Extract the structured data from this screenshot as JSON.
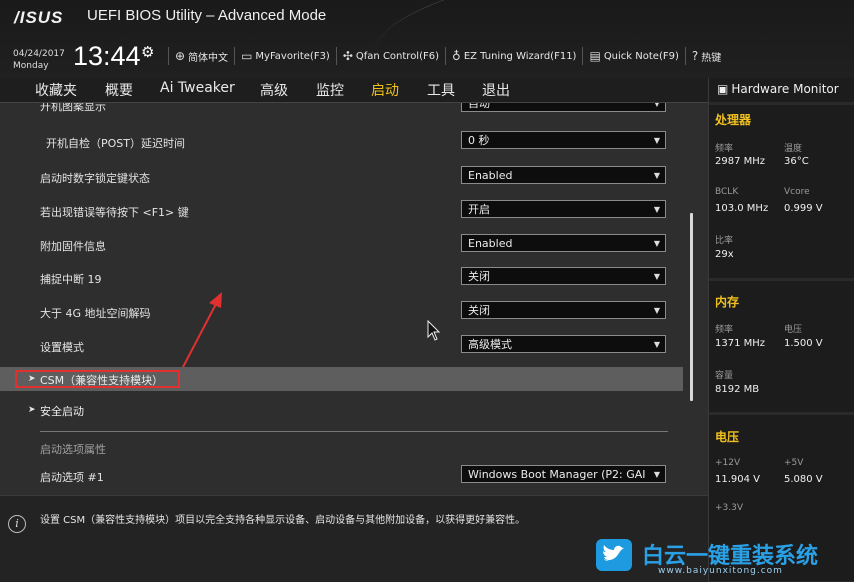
{
  "header": {
    "logo": "/ISUS",
    "title": "UEFI BIOS Utility – Advanced Mode",
    "date": "04/24/2017",
    "weekday": "Monday",
    "time": "13:44",
    "tools": [
      {
        "icon": "globe-icon",
        "label": "简体中文"
      },
      {
        "icon": "favorite-icon",
        "label": "MyFavorite(F3)"
      },
      {
        "icon": "fan-icon",
        "label": "Qfan Control(F6)"
      },
      {
        "icon": "bulb-icon",
        "label": "EZ Tuning Wizard(F11)"
      },
      {
        "icon": "note-icon",
        "label": "Quick Note(F9)"
      },
      {
        "icon": "help-icon",
        "label": "热键"
      }
    ]
  },
  "menu": {
    "tabs": [
      "收藏夹",
      "概要",
      "Ai Tweaker",
      "高级",
      "监控",
      "启动",
      "工具",
      "退出"
    ],
    "active": "启动"
  },
  "settings": [
    {
      "label": "开机自检（POST）延迟时间",
      "value": "0 秒"
    },
    {
      "label": "启动时数字锁定键状态",
      "value": "Enabled"
    },
    {
      "label": "若出现错误等待按下 <F1> 键",
      "value": "开启"
    },
    {
      "label": "附加固件信息",
      "value": "Enabled"
    },
    {
      "label": "捕捉中断 19",
      "value": "关闭"
    },
    {
      "label": "大于 4G 地址空间解码",
      "value": "关闭"
    },
    {
      "label": "设置模式",
      "value": "高级模式"
    }
  ],
  "top_partial": {
    "label": "开机图案显示",
    "value": "自动"
  },
  "submenus": {
    "csm": "CSM（兼容性支持模块）",
    "secure_boot": "安全启动"
  },
  "boot_options": {
    "section_title": "启动选项属性",
    "option1_label": "启动选项 #1",
    "option1_value": "Windows Boot Manager (P2: GAI"
  },
  "help_text": "设置 CSM（兼容性支持模块）项目以完全支持各种显示设备、启动设备与其他附加设备，以获得更好兼容性。",
  "hardware_monitor": {
    "title": "Hardware Monitor",
    "cpu": {
      "section": "处理器",
      "freq_label": "频率",
      "freq_value": "2987 MHz",
      "temp_label": "温度",
      "temp_value": "36°C",
      "bclk_label": "BCLK",
      "bclk_value": "103.0 MHz",
      "vcore_label": "Vcore",
      "vcore_value": "0.999 V",
      "ratio_label": "比率",
      "ratio_value": "29x"
    },
    "memory": {
      "section": "内存",
      "freq_label": "频率",
      "freq_value": "1371 MHz",
      "volt_label": "电压",
      "volt_value": "1.500 V",
      "cap_label": "容量",
      "cap_value": "8192 MB"
    },
    "voltage": {
      "section": "电压",
      "v12_label": "+12V",
      "v12_value": "11.904 V",
      "v5_label": "+5V",
      "v5_value": "5.080 V",
      "v33_label": "+3.3V"
    }
  },
  "watermark": {
    "title": "白云一键重装系统",
    "url": "www.baiyunxitong.com"
  },
  "colors": {
    "accent": "#f2c218",
    "highlight_box": "#e03030",
    "watermark": "#2aa0e6"
  }
}
